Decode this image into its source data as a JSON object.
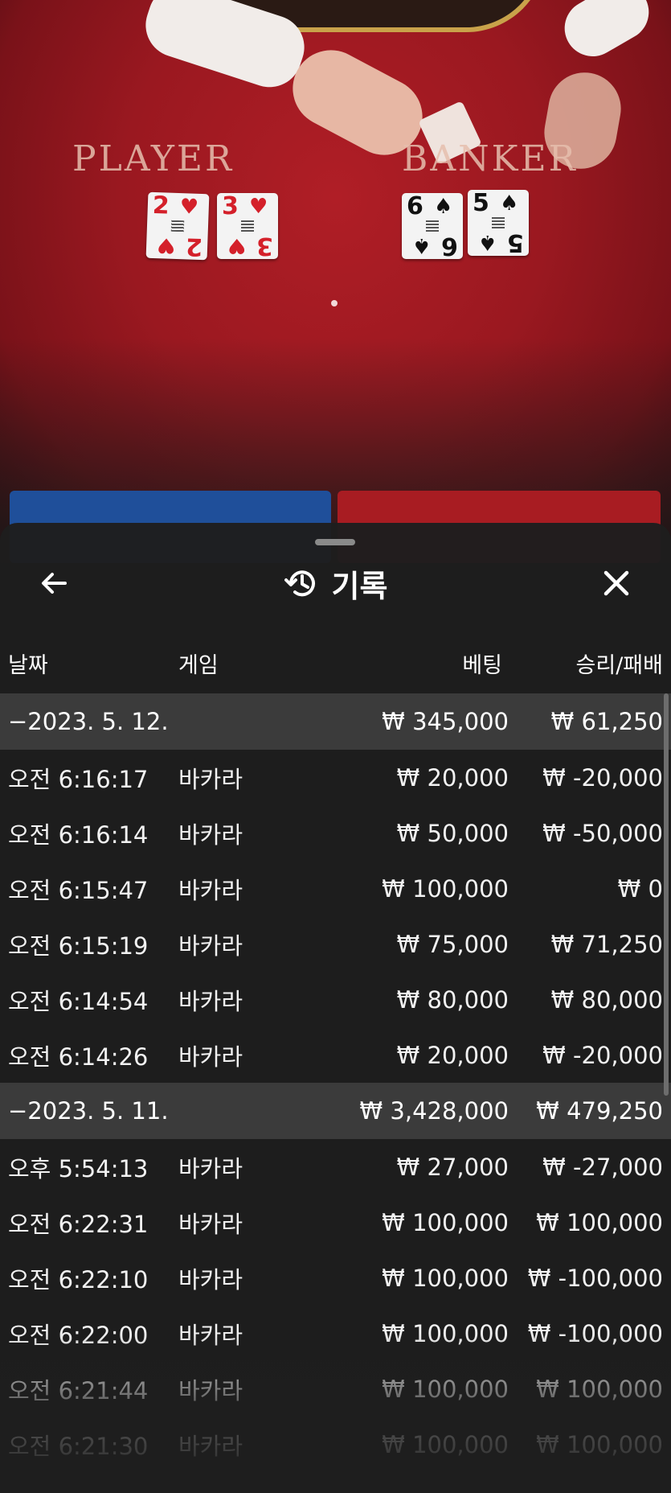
{
  "table": {
    "player_label": "PLAYER",
    "banker_label": "BANKER",
    "player_cards": [
      {
        "rank": "2",
        "suit": "♥"
      },
      {
        "rank": "3",
        "suit": "♥"
      }
    ],
    "banker_cards": [
      {
        "rank": "6",
        "suit": "♠"
      },
      {
        "rank": "5",
        "suit": "♠"
      }
    ]
  },
  "panel": {
    "title": "기록",
    "icons": {
      "back": "arrow-left-icon",
      "history": "history-icon",
      "close": "close-icon"
    },
    "columns": {
      "date": "날짜",
      "game": "게임",
      "bet": "베팅",
      "result": "승리/패배"
    },
    "groups": [
      {
        "date": "−2023. 5. 12.",
        "bet": "₩ 345,000",
        "result": "₩ 61,250",
        "rows": [
          {
            "time": "오전 6:16:17",
            "game": "바카라",
            "bet": "₩ 20,000",
            "result": "₩ -20,000"
          },
          {
            "time": "오전 6:16:14",
            "game": "바카라",
            "bet": "₩ 50,000",
            "result": "₩ -50,000"
          },
          {
            "time": "오전 6:15:47",
            "game": "바카라",
            "bet": "₩ 100,000",
            "result": "₩ 0"
          },
          {
            "time": "오전 6:15:19",
            "game": "바카라",
            "bet": "₩ 75,000",
            "result": "₩ 71,250"
          },
          {
            "time": "오전 6:14:54",
            "game": "바카라",
            "bet": "₩ 80,000",
            "result": "₩ 80,000"
          },
          {
            "time": "오전 6:14:26",
            "game": "바카라",
            "bet": "₩ 20,000",
            "result": "₩ -20,000"
          }
        ]
      },
      {
        "date": "−2023. 5. 11.",
        "bet": "₩ 3,428,000",
        "result": "₩ 479,250",
        "rows": [
          {
            "time": "오후 5:54:13",
            "game": "바카라",
            "bet": "₩ 27,000",
            "result": "₩ -27,000"
          },
          {
            "time": "오전 6:22:31",
            "game": "바카라",
            "bet": "₩ 100,000",
            "result": "₩ 100,000"
          },
          {
            "time": "오전 6:22:10",
            "game": "바카라",
            "bet": "₩ 100,000",
            "result": "₩ -100,000"
          },
          {
            "time": "오전 6:22:00",
            "game": "바카라",
            "bet": "₩ 100,000",
            "result": "₩ -100,000"
          },
          {
            "time": "오전 6:21:44",
            "game": "바카라",
            "bet": "₩ 100,000",
            "result": "₩ 100,000"
          },
          {
            "time": "오전 6:21:30",
            "game": "바카라",
            "bet": "₩ 100,000",
            "result": "₩ 100,000"
          }
        ]
      }
    ]
  }
}
